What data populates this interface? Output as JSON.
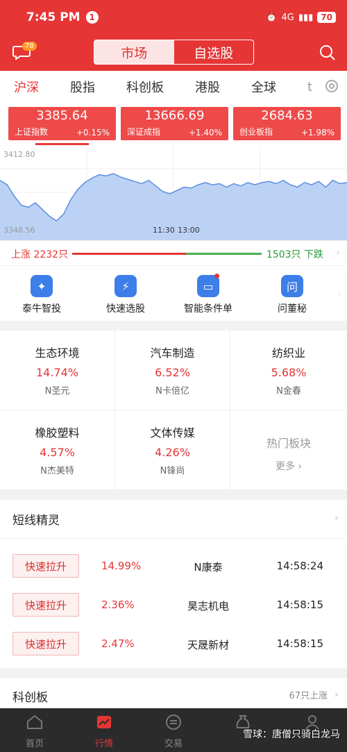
{
  "status": {
    "time": "7:45 PM",
    "notif_count": "1",
    "network": "4G",
    "battery": "70"
  },
  "header": {
    "message_badge": "78",
    "tabs": [
      "市场",
      "自选股"
    ]
  },
  "market_tabs": [
    "沪深",
    "股指",
    "科创板",
    "港股",
    "全球",
    "t"
  ],
  "indices": [
    {
      "value": "3385.64",
      "name": "上证指数",
      "change": "+0.15%"
    },
    {
      "value": "13666.69",
      "name": "深证成指",
      "change": "+1.40%"
    },
    {
      "value": "2684.63",
      "name": "创业板指",
      "change": "+1.98%"
    }
  ],
  "chart": {
    "high": "3412.80",
    "low": "3348.56",
    "time1": "11:30",
    "time2": "13:00"
  },
  "chart_data": {
    "type": "area",
    "ylim": [
      3348.56,
      3412.8
    ],
    "values": [
      3392,
      3388,
      3378,
      3370,
      3368,
      3372,
      3366,
      3360,
      3356,
      3362,
      3375,
      3384,
      3390,
      3394,
      3397,
      3396,
      3398,
      3395,
      3393,
      3391,
      3389,
      3392,
      3387,
      3382,
      3380,
      3383,
      3386,
      3385,
      3388,
      3390,
      3388,
      3389,
      3386,
      3389,
      3387,
      3390,
      3388,
      3390,
      3391,
      3389,
      3392,
      3388,
      3386,
      3390,
      3388,
      3391,
      3386,
      3392,
      3389,
      3390
    ]
  },
  "breadth": {
    "up": "上涨 2232只",
    "down": "1503只 下跌",
    "up_ratio": 0.6
  },
  "quick_tools": [
    "泰牛智投",
    "快速选股",
    "智能条件单",
    "问董秘"
  ],
  "sectors": [
    {
      "name": "生态环境",
      "pct": "14.74%",
      "stock": "N圣元"
    },
    {
      "name": "汽车制造",
      "pct": "6.52%",
      "stock": "N卡倍亿"
    },
    {
      "name": "纺织业",
      "pct": "5.68%",
      "stock": "N金春"
    },
    {
      "name": "橡胶塑料",
      "pct": "4.57%",
      "stock": "N杰美特"
    },
    {
      "name": "文体传媒",
      "pct": "4.26%",
      "stock": "N锋尚"
    }
  ],
  "hot_sectors": {
    "label": "热门板块",
    "more": "更多"
  },
  "spirit": {
    "title": "短线精灵",
    "rows": [
      {
        "tag": "快速拉升",
        "pct": "14.99%",
        "name": "N康泰",
        "time": "14:58:24"
      },
      {
        "tag": "快速拉升",
        "pct": "2.36%",
        "name": "昊志机电",
        "time": "14:58:15"
      },
      {
        "tag": "快速拉升",
        "pct": "2.47%",
        "name": "天晟新材",
        "time": "14:58:15"
      }
    ]
  },
  "kcb": {
    "title": "科创板",
    "count": "67只上涨"
  },
  "bottom_nav": [
    "首页",
    "行情",
    "交易",
    "",
    ""
  ],
  "watermark": "雪球：唐僧只骑白龙马"
}
